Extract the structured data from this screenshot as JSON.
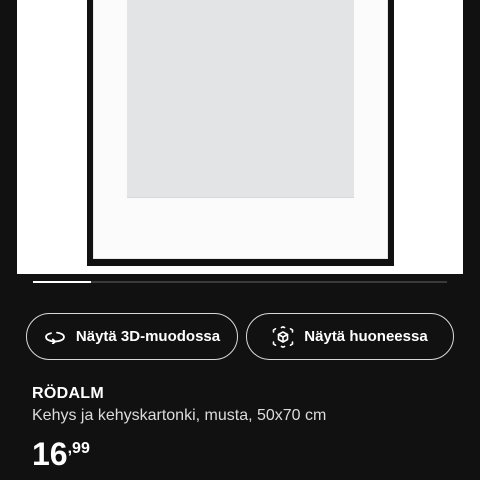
{
  "gallery": {
    "image_alt": "RÖDALM",
    "progress_fraction": 0.14
  },
  "actions": {
    "view_3d_label": "Näytä 3D-muodossa",
    "view_in_room_label": "Näytä huoneessa"
  },
  "product": {
    "name": "RÖDALM",
    "description": "Kehys ja kehyskartonki, musta, 50x70 cm",
    "price_integer": "16",
    "price_decimal": ",99"
  },
  "colors": {
    "background": "#111111",
    "text": "#ffffff",
    "frame": "#111111",
    "mat": "#fbfbfb",
    "opening": "#e2e4e6"
  },
  "icons": {
    "view_3d": "rotate-3d-icon",
    "view_in_room": "augmented-reality-cube-icon"
  }
}
